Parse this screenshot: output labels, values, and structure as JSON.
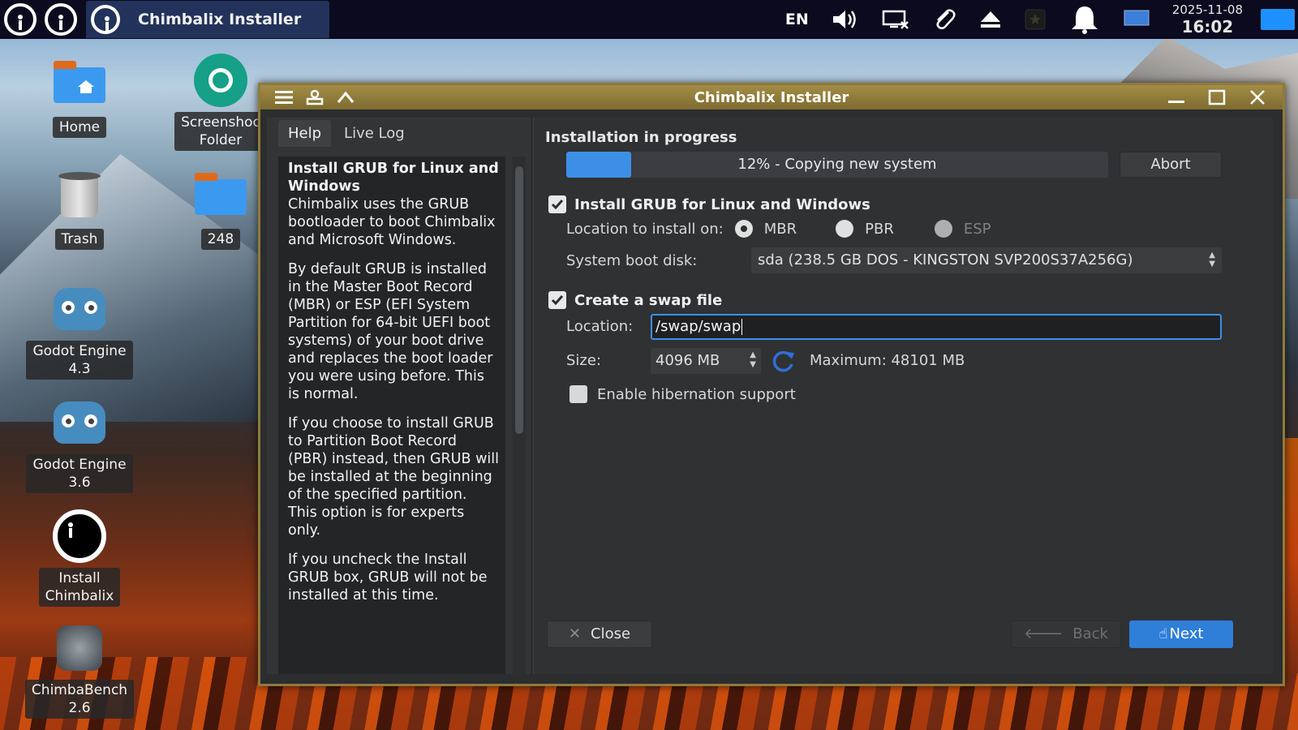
{
  "taskbar": {
    "window_label": "Chimbalix Installer",
    "keyboard_layout": "EN",
    "clock_date": "2025-11-08",
    "clock_time": "16:02"
  },
  "desktop_icons": [
    {
      "label": "Home"
    },
    {
      "label": "Screenshot\nFolder",
      "label_display": "Screenshoc\nFolder"
    },
    {
      "label": "Trash"
    },
    {
      "label": "248"
    },
    {
      "label": "Godot Engine 4.3",
      "line1": "Godot Engine",
      "line2": "4.3"
    },
    {
      "label": "Godot Engine 3.6",
      "line1": "Godot Engine",
      "line2": "3.6"
    },
    {
      "label": "Install Chimbalix",
      "line1": "Install",
      "line2": "Chimbalix"
    },
    {
      "label": "ChimbaBench 2.6",
      "line1": "ChimbaBench",
      "line2": "2.6"
    }
  ],
  "window": {
    "title": "Chimbalix Installer",
    "tabs": [
      {
        "label": "Help",
        "active": true
      },
      {
        "label": "Live Log",
        "active": false
      }
    ],
    "help": {
      "heading": "Install GRUB for Linux and Windows",
      "p1": "Chimbalix uses the GRUB bootloader to boot Chimbalix and Microsoft Windows.",
      "p2": "By default GRUB is installed in the Master Boot Record (MBR) or ESP (EFI System Partition for 64-bit UEFI boot systems) of your boot drive and replaces the boot loader you were using before. This is normal.",
      "p3": "If you choose to install GRUB to Partition Boot Record (PBR) instead, then GRUB will be installed at the beginning of the specified partition. This option is for experts only.",
      "p4": "If you uncheck the Install GRUB box, GRUB will not be installed at this time."
    },
    "progress": {
      "title": "Installation in progress",
      "percent": 12,
      "text": "12% - Copying new system",
      "abort_label": "Abort"
    },
    "grub": {
      "checkbox_label": "Install GRUB for Linux and Windows",
      "checked": true,
      "location_label": "Location to install on:",
      "options": [
        {
          "label": "MBR",
          "selected": true,
          "enabled": true
        },
        {
          "label": "PBR",
          "selected": false,
          "enabled": true
        },
        {
          "label": "ESP",
          "selected": false,
          "enabled": false
        }
      ],
      "boot_disk_label": "System boot disk:",
      "boot_disk_value": "sda (238.5 GB DOS - KINGSTON SVP200S37A256G)"
    },
    "swap": {
      "checkbox_label": "Create a swap file",
      "checked": true,
      "location_label": "Location:",
      "location_value": "/swap/swap",
      "size_label": "Size:",
      "size_value": "4096 MB",
      "maximum_text": "Maximum: 48101 MB",
      "hibernation_label": "Enable hibernation support",
      "hibernation_checked": false
    },
    "buttons": {
      "close": "Close",
      "back": "Back",
      "next": "Next"
    }
  },
  "colors": {
    "accent": "#3d8fe6",
    "titlebar": "#8e7b3c",
    "panel": "#0c0a1e"
  }
}
